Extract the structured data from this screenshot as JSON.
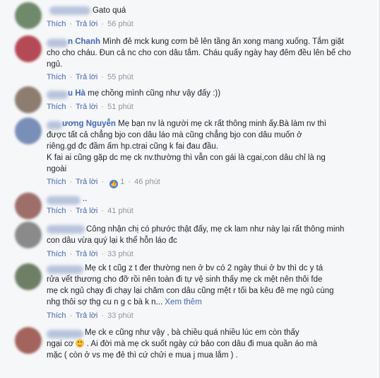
{
  "labels": {
    "like": "Thích",
    "reply": "Trả lời",
    "separator": "·",
    "see_more": "Xem thêm"
  },
  "comments": [
    {
      "author_suffix": "",
      "text": "Gato quá",
      "time": "56 phút",
      "avatar_color": "#6f8a6a"
    },
    {
      "author_suffix": "n Chanh",
      "text": "Mình đẻ mck kung cơm bê lên tầng ăn xong mang xuống. Tắm giặt cho cho cháu. Đun cả nc cho con dâu tắm. Cháu quấy ngày hay đêm đều lên bế cho ngủ.",
      "time": "55 phút",
      "avatar_color": "#b54a57"
    },
    {
      "author_suffix": "u Hà",
      "text": "mẹ chồng mình cũng như vậy đấy :))",
      "time": "51 phút",
      "avatar_color": "#8c7d70"
    },
    {
      "author_suffix": "ương Nguyễn",
      "text_lines": [
        "Mẹ bạn nv là người mẹ ck rất thông minh ấy.Bà làm nv thì",
        "được tất cả chẳng bjo con dâu láo mà cũng chẳng bjo con dâu muốn ở",
        "riêng.gd đc đầm ấm hp.ctrai cũng k fai đau đầu.",
        "K fai ai cũng gặp dc mẹ ck nv.thường thì vẫn con gái là cgai,con dâu chỉ là ng",
        "ngoài"
      ],
      "time": "46 phút",
      "reactions": "1",
      "avatar_color": "#7a8fb8"
    },
    {
      "author_suffix": "",
      "text": "..",
      "time": "41 phút",
      "avatar_color": "#9e6f6a"
    },
    {
      "author_suffix": "",
      "text": "Công nhận chị có phước thật đấy, mẹ ck lam như này lại rất thông minh con dâu vừa quý lại k thể hỗn láo đc",
      "time": "33 phút",
      "avatar_color": "#8a8a8a"
    },
    {
      "author_suffix": "",
      "text_lines": [
        "Mẹ ck t cũg z t đer thường nen ở bv có 2 ngày thui ở bv thì dc y tá",
        "rửa vết thương cho đỡ rồi nên toàn đi tự vệ sinh thấy mẹ ck mệt nên thôi fde",
        "mẹ ck ngủ chạy đi chạy lại chăm con dâu cũng mệt r tối ba kêu đê mẹ ngủ cùng",
        "nhg thôi sợ thg cu n g c bà k n..."
      ],
      "time": "33 phút",
      "avatar_color": "#6f7f66"
    },
    {
      "author_suffix": "",
      "text_lines": [
        "Mẹ ck e cũng như vậy , bà chiều quá nhiều lúc em còn thấy",
        "ngại cơ",
        ". Ai đời mà mẹ ck suốt ngày cứ bảo con dâu đi mua quần áo mà",
        "mặc ( còn ở vs mẹ đẻ thì cứ chửi e mua j mua lắm ) ."
      ],
      "time": "",
      "avatar_color": "#a4645e"
    }
  ]
}
